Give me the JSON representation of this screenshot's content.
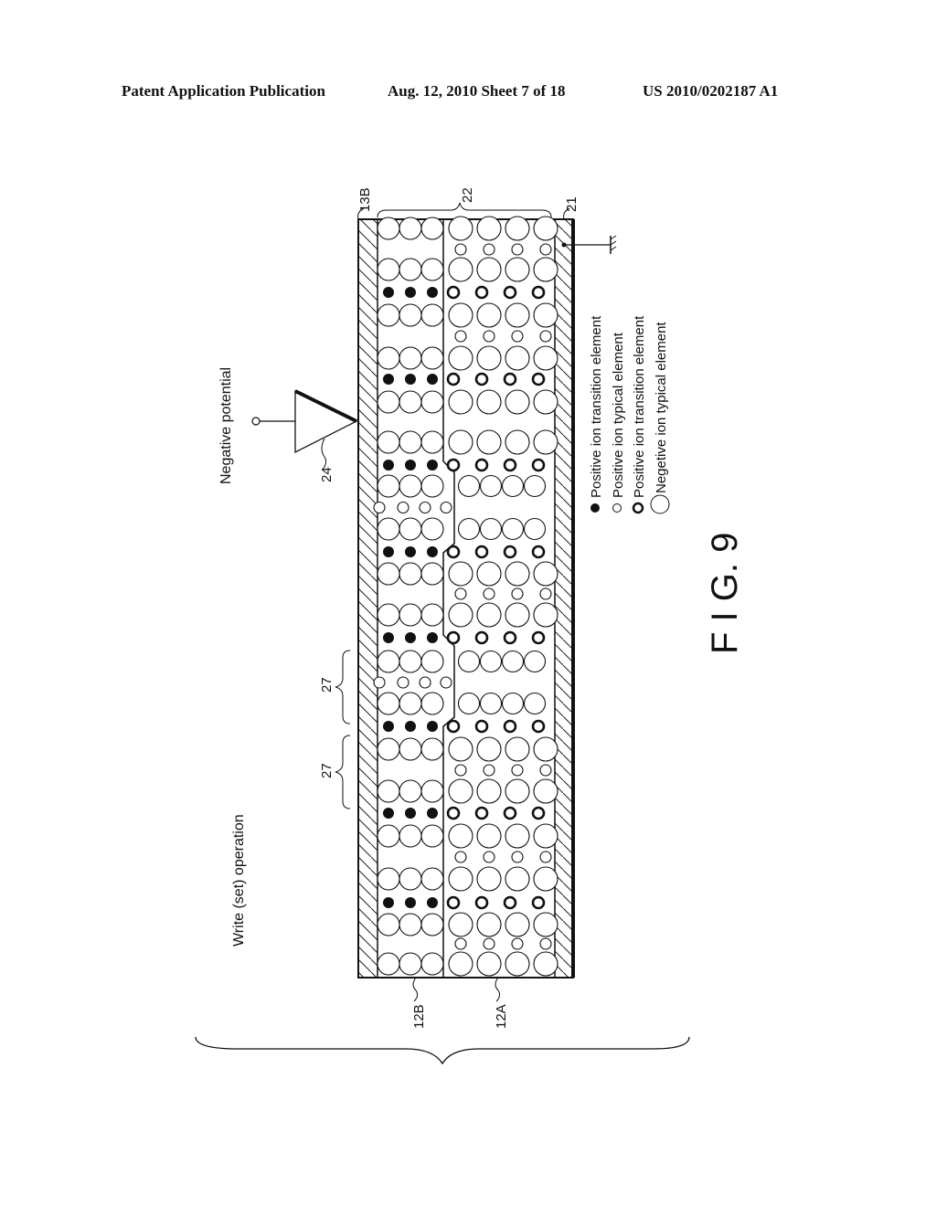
{
  "header": {
    "left": "Patent Application Publication",
    "middle": "Aug. 12, 2010  Sheet 7 of 18",
    "right": "US 2010/0202187 A1"
  },
  "figure": {
    "caption": "F I G. 9",
    "operation_label": "Write (set) operation",
    "potential_label": "Negative potential",
    "ref_labels": {
      "electrode_top": "13B",
      "layer_group": "22",
      "electrode_bottom": "21",
      "probe": "24",
      "cell_a": "27",
      "cell_b": "27",
      "layer_b": "12B",
      "layer_a": "12A"
    },
    "legend": [
      {
        "symbol": "filled-small-circle",
        "label": "Positive ion transition element"
      },
      {
        "symbol": "small-open-circle",
        "label": "Positive ion typical element"
      },
      {
        "symbol": "thick-ring",
        "label": "Positive ion transition element"
      },
      {
        "symbol": "large-open-circle",
        "label": "Negetive ion typical element"
      }
    ]
  }
}
